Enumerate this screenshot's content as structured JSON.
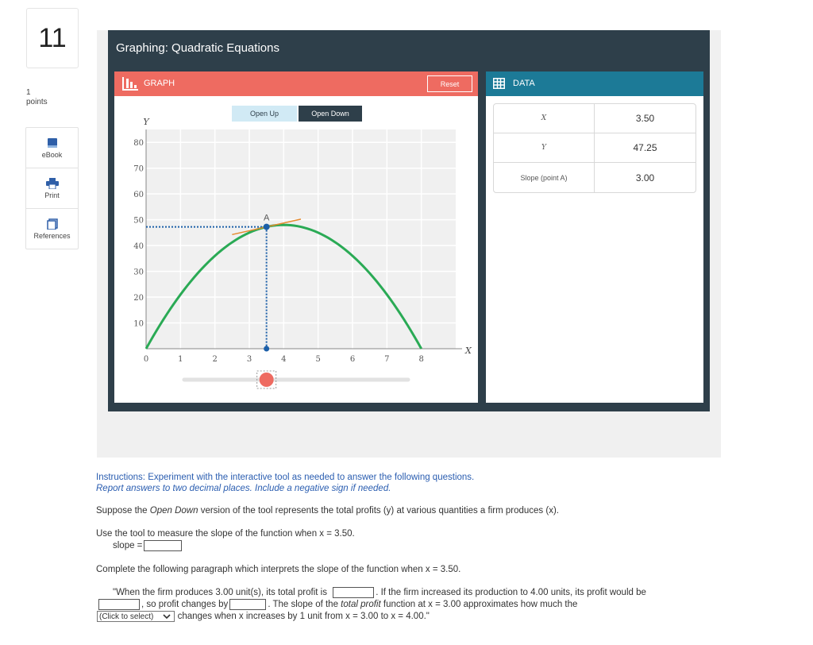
{
  "question": {
    "number": "11",
    "points_value": "1",
    "points_label": "points"
  },
  "tools": [
    {
      "label": "eBook",
      "icon": "book-icon"
    },
    {
      "label": "Print",
      "icon": "print-icon"
    },
    {
      "label": "References",
      "icon": "references-icon"
    }
  ],
  "app": {
    "title": "Graphing: Quadratic Equations",
    "graph_panel": {
      "title": "GRAPH",
      "reset_label": "Reset",
      "open_up_label": "Open Up",
      "open_down_label": "Open Down"
    },
    "data_panel": {
      "title": "DATA",
      "rows": [
        {
          "label": "X",
          "value": "3.50"
        },
        {
          "label": "Y",
          "value": "47.25"
        },
        {
          "label": "Slope (point A)",
          "value": "3.00"
        }
      ]
    }
  },
  "chart_data": {
    "type": "line",
    "mode": "open-down",
    "xlabel": "X",
    "ylabel": "Y",
    "xlim": [
      0,
      9
    ],
    "ylim": [
      0,
      85
    ],
    "xticks": [
      0,
      1,
      2,
      3,
      4,
      5,
      6,
      7,
      8
    ],
    "yticks": [
      10,
      20,
      30,
      40,
      50,
      60,
      70,
      80
    ],
    "curve": {
      "function": "y = 24x - 3x^2",
      "x_range": [
        0,
        8
      ],
      "color": "#2aaa55"
    },
    "point": {
      "label": "A",
      "x": 3.5,
      "y": 47.25,
      "slope": 3.0
    },
    "slider_value": 3.5,
    "slider_range": [
      0,
      8
    ],
    "colors": {
      "curve": "#2aaa55",
      "tangent": "#e68a2e",
      "point": "#1c5fa8",
      "slider_handle": "#ee6b61"
    }
  },
  "instructions": {
    "line1": "Instructions: Experiment with the interactive tool as needed to answer the following questions.",
    "line2": "Report answers to two decimal places.  Include a negative sign if needed."
  },
  "prompt": {
    "p1_pre": "Suppose the ",
    "p1_em": "Open Down",
    "p1_post": " version of the tool represents the total profits (y) at various quantities a firm produces (x).",
    "p2": "Use the tool to measure the slope of the function when x = 3.50.",
    "slope_label": "slope =",
    "p3": "Complete the following paragraph which interprets the slope of the function when x = 3.50.",
    "q1": "\"When the firm produces 3.00 unit(s), its total profit is",
    "q2": ". If the firm increased its production to 4.00 units, its profit would be",
    "q3": ", so profit changes by",
    "q4": ". The slope of the",
    "q4_em": "total profit",
    "q5": "function at x = 3.00 approximates how much the",
    "select_value": "(Click to select)",
    "q6": "changes when x increases by 1 unit from x = 3.00 to x = 4.00.\""
  }
}
